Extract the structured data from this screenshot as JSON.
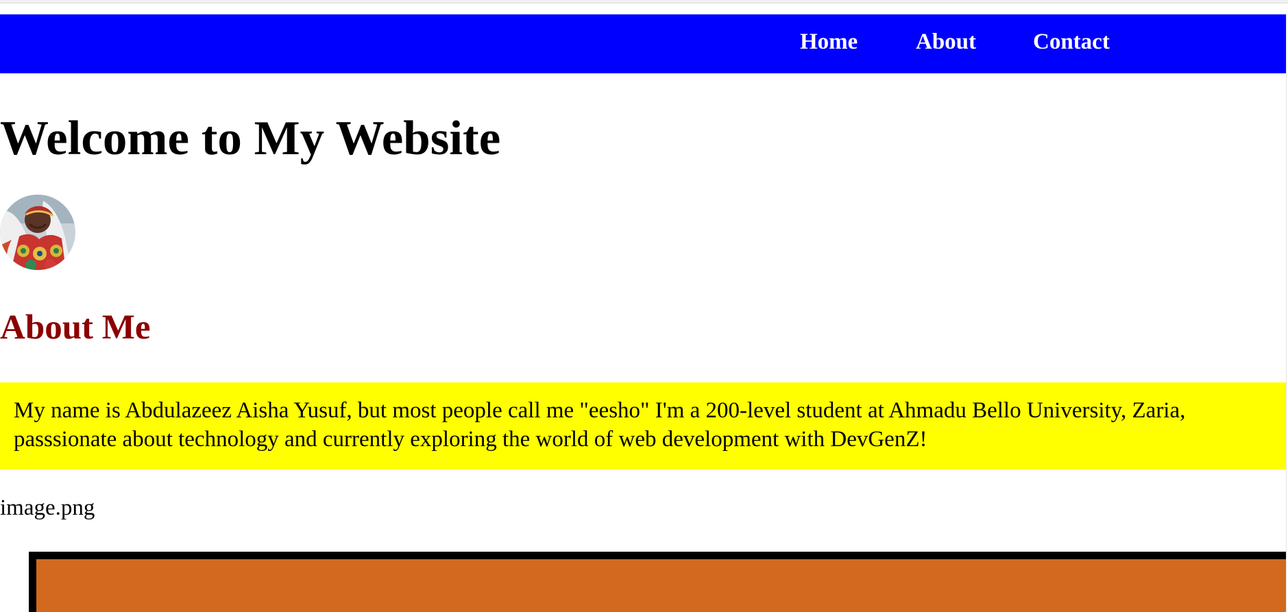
{
  "nav": {
    "items": [
      {
        "label": "Home"
      },
      {
        "label": "About"
      },
      {
        "label": "Contact"
      }
    ]
  },
  "header": {
    "title": "Welcome to My Website"
  },
  "profile": {
    "avatar_icon": "profile-photo-icon"
  },
  "about": {
    "heading": "About Me",
    "line1": "My name is Abdulazeez Aisha Yusuf, but most people call me \"eesho\" I'm a 200-level student at Ahmadu Bello University, Zaria,",
    "line2": "passsionate about technology and currently exploring the world of web development with DevGenZ!"
  },
  "image_caption": "image.png",
  "orange_section": {
    "text": ""
  },
  "colors": {
    "nav_background": "#0000ff",
    "nav_text": "#ffffff",
    "heading_accent": "#8b0000",
    "about_background": "#ffff00",
    "orange_box": "#d2691e",
    "orange_border": "#000000"
  }
}
